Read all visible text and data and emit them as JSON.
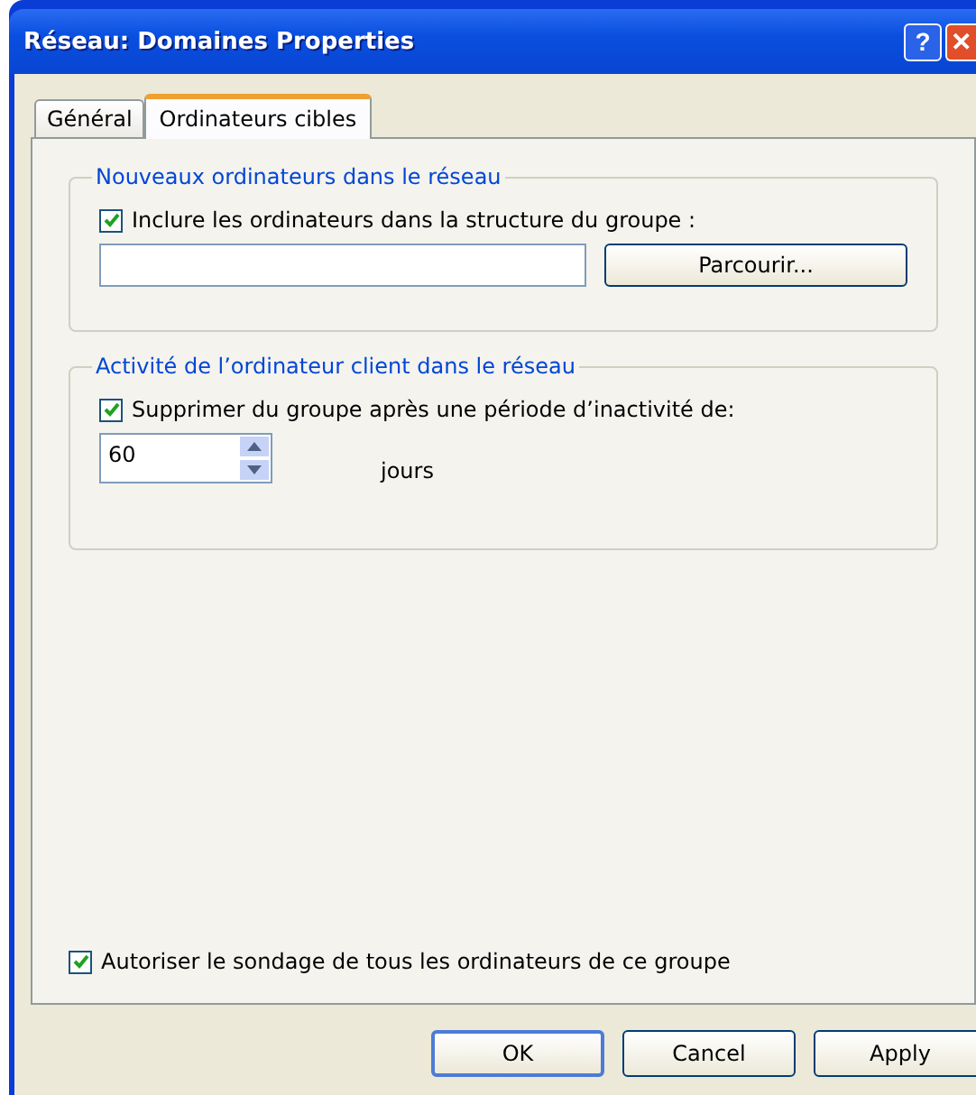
{
  "window": {
    "title": "Réseau: Domaines Properties",
    "help_button": "?",
    "close_button": "✕"
  },
  "tabs": [
    {
      "label": "Général",
      "selected": false
    },
    {
      "label": "Ordinateurs cibles",
      "selected": true
    }
  ],
  "groups": [
    {
      "title": "Nouveaux ordinateurs dans le réseau",
      "checkbox": {
        "label": "Inclure les ordinateurs dans la structure du groupe :",
        "checked": true
      },
      "kind": "browse",
      "browse_button": "Parcourir..."
    },
    {
      "title": "Activité de l’ordinateur client dans le réseau",
      "checkbox": {
        "label": "Supprimer du groupe après une période d’inactivité de:",
        "checked": true
      },
      "kind": "spin",
      "value": "60",
      "unit": "jours"
    }
  ],
  "bottom_checkbox": {
    "label": "Autoriser le sondage de tous les ordinateurs de ce groupe",
    "checked": true
  },
  "buttons": [
    "OK",
    "Cancel",
    "Apply"
  ]
}
